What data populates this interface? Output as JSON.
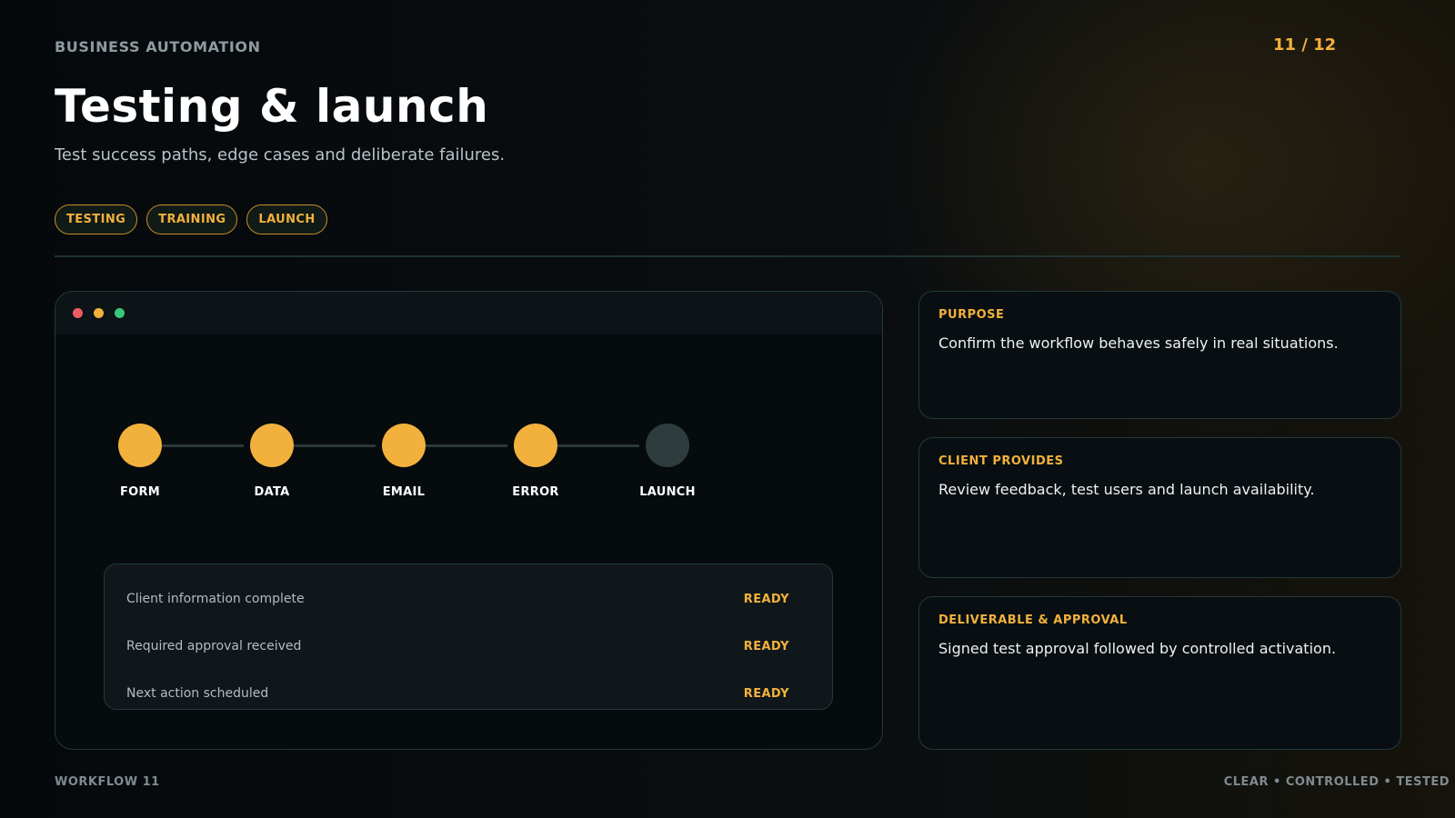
{
  "header": {
    "kicker": "BUSINESS AUTOMATION",
    "page_counter": "11 / 12",
    "title": "Testing & launch",
    "subtitle": "Test success paths, edge cases and deliberate failures."
  },
  "tags": [
    "TESTING",
    "TRAINING",
    "LAUNCH"
  ],
  "window": {
    "controls": [
      "close-dot",
      "minimize-dot",
      "maximize-dot"
    ],
    "steps": [
      {
        "label": "FORM",
        "state": "complete"
      },
      {
        "label": "DATA",
        "state": "complete"
      },
      {
        "label": "EMAIL",
        "state": "complete"
      },
      {
        "label": "ERROR",
        "state": "complete"
      },
      {
        "label": "LAUNCH",
        "state": "pending"
      }
    ],
    "checklist": [
      {
        "text": "Client information complete",
        "status": "READY"
      },
      {
        "text": "Required approval received",
        "status": "READY"
      },
      {
        "text": "Next action scheduled",
        "status": "READY"
      }
    ]
  },
  "cards": [
    {
      "label": "PURPOSE",
      "text": "Confirm the workflow behaves safely in real situations."
    },
    {
      "label": "CLIENT PROVIDES",
      "text": "Review feedback, test users and launch availability."
    },
    {
      "label": "DELIVERABLE & APPROVAL",
      "text": "Signed test approval followed by controlled activation."
    }
  ],
  "footer": {
    "left": "WORKFLOW 11",
    "right": "CLEAR • CONTROLLED • TESTED"
  },
  "colors": {
    "accent": "#f2b13c",
    "background": "#05090c",
    "border": "#22393a",
    "pending": "#2e3c3d"
  }
}
